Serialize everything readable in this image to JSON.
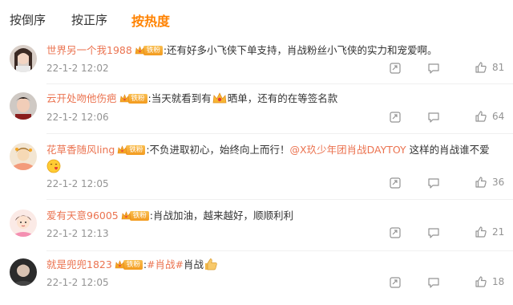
{
  "sort_tabs": [
    {
      "label": "按倒序",
      "active": false
    },
    {
      "label": "按正序",
      "active": false
    },
    {
      "label": "按热度",
      "active": true
    }
  ],
  "badge_label": "铁粉",
  "comments": [
    {
      "username": "世界另一个我1988",
      "text": ":还有好多小飞侠下单支持，肖战粉丝小飞侠的实力和宠爱啊。",
      "time": "22-1-2 12:02",
      "likes": "81"
    },
    {
      "username": "云开处吻他伤疤",
      "text_before": ":当天就看到有",
      "text_after": "晒单，还有的在等签名款",
      "time": "22-1-2 12:06",
      "likes": "64"
    },
    {
      "username": "花草香随风ling",
      "text": ":不负进取初心，始终向上而行！",
      "mention": "@X玖少年团肖战DAYTOY",
      "text_after": " 这样的肖战谁不爱",
      "time": "22-1-2 12:05",
      "likes": "36"
    },
    {
      "username": "爱有天意96005",
      "text": ":肖战加油，越来越好，顺顺利利",
      "time": "22-1-2 12:13",
      "likes": "21"
    },
    {
      "username": "就是兜兜1823",
      "text_sep": ":",
      "hashtag": "#肖战#",
      "text_after": "肖战",
      "time": "22-1-2 12:05",
      "likes": "18"
    }
  ],
  "colors": {
    "accent": "#ff8200",
    "username": "#eb7350",
    "meta": "#939393"
  }
}
